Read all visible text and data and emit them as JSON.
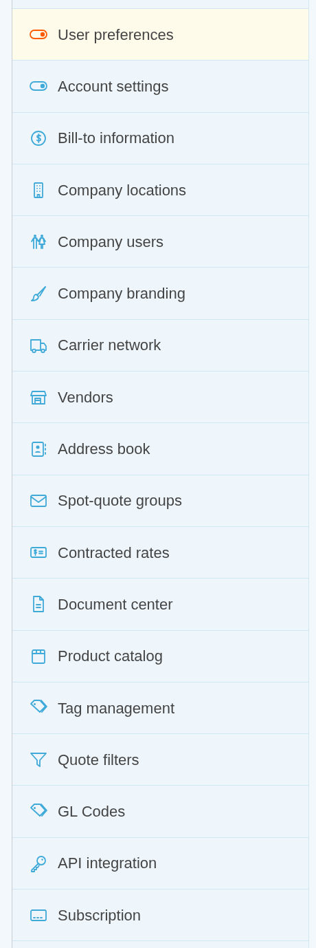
{
  "menu": {
    "items": [
      {
        "label": "User preferences",
        "selected": true
      },
      {
        "label": "Account settings",
        "selected": false
      },
      {
        "label": "Bill-to information",
        "selected": false
      },
      {
        "label": "Company locations",
        "selected": false
      },
      {
        "label": "Company users",
        "selected": false
      },
      {
        "label": "Company branding",
        "selected": false
      },
      {
        "label": "Carrier network",
        "selected": false
      },
      {
        "label": "Vendors",
        "selected": false
      },
      {
        "label": "Address book",
        "selected": false
      },
      {
        "label": "Spot-quote groups",
        "selected": false
      },
      {
        "label": "Contracted rates",
        "selected": false
      },
      {
        "label": "Document center",
        "selected": false
      },
      {
        "label": "Product catalog",
        "selected": false
      },
      {
        "label": "Tag management",
        "selected": false
      },
      {
        "label": "Quote filters",
        "selected": false
      },
      {
        "label": "GL Codes",
        "selected": false
      },
      {
        "label": "API integration",
        "selected": false
      },
      {
        "label": "Subscription",
        "selected": false
      }
    ]
  }
}
